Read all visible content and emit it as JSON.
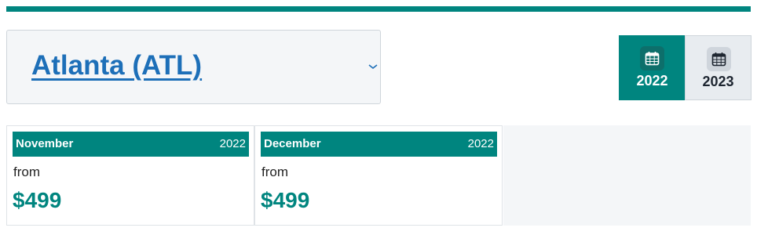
{
  "origin": {
    "selected_city": "Atlanta (ATL)"
  },
  "years": [
    {
      "label": "2022",
      "active": true
    },
    {
      "label": "2023",
      "active": false
    }
  ],
  "months": [
    {
      "name": "November",
      "year": "2022",
      "from_label": "from",
      "price": "$499"
    },
    {
      "name": "December",
      "year": "2022",
      "from_label": "from",
      "price": "$499"
    }
  ],
  "colors": {
    "accent": "#00857f",
    "link": "#1d6fb8",
    "panel_bg": "#f4f6f8"
  },
  "icons": {
    "dropdown": "chevron-down-icon",
    "year": "calendar-icon"
  }
}
